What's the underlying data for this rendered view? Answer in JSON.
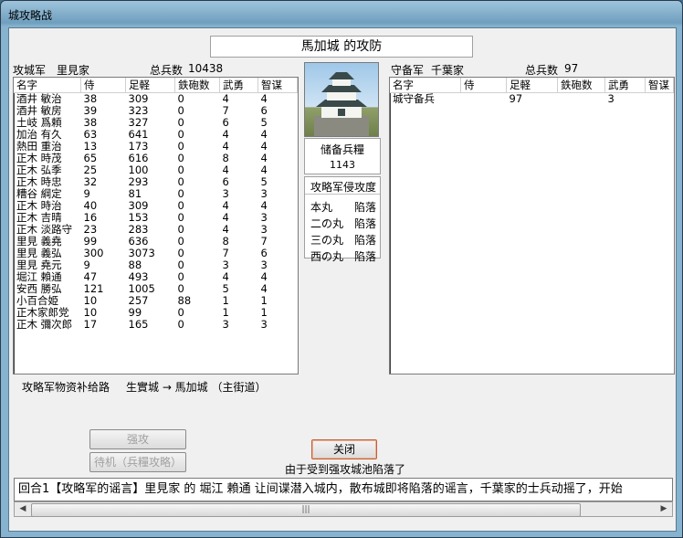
{
  "window": {
    "title": "城攻略战"
  },
  "header": {
    "caption": "馬加城 的攻防"
  },
  "attacker": {
    "label": "攻城军",
    "name": "里見家",
    "total_label": "总兵数",
    "total": "10438",
    "columns": [
      "名字",
      "侍",
      "足軽",
      "鉄砲数",
      "武勇",
      "智谋"
    ],
    "rows": [
      [
        "酒井 敏治",
        "38",
        "309",
        "0",
        "4",
        "4"
      ],
      [
        "酒井 敏房",
        "39",
        "323",
        "0",
        "7",
        "6"
      ],
      [
        "土岐 爲頼",
        "38",
        "327",
        "0",
        "6",
        "5"
      ],
      [
        "加治 有久",
        "63",
        "641",
        "0",
        "4",
        "4"
      ],
      [
        "熱田 重治",
        "13",
        "173",
        "0",
        "4",
        "4"
      ],
      [
        "正木 時茂",
        "65",
        "616",
        "0",
        "8",
        "4"
      ],
      [
        "正木 弘季",
        "25",
        "100",
        "0",
        "4",
        "4"
      ],
      [
        "正木 時忠",
        "32",
        "293",
        "0",
        "6",
        "5"
      ],
      [
        "糟谷 綱定",
        "9",
        "81",
        "0",
        "3",
        "3"
      ],
      [
        "正木 時治",
        "40",
        "309",
        "0",
        "4",
        "4"
      ],
      [
        "正木 吉晴",
        "16",
        "153",
        "0",
        "4",
        "3"
      ],
      [
        "正木 淡路守",
        "23",
        "283",
        "0",
        "4",
        "3"
      ],
      [
        "里見 義堯",
        "99",
        "636",
        "0",
        "8",
        "7"
      ],
      [
        "里見 義弘",
        "300",
        "3073",
        "0",
        "7",
        "6"
      ],
      [
        "里見 堯元",
        "9",
        "88",
        "0",
        "3",
        "3"
      ],
      [
        "堀江 賴通",
        "47",
        "493",
        "0",
        "4",
        "4"
      ],
      [
        "安西 勝弘",
        "121",
        "1005",
        "0",
        "5",
        "4"
      ],
      [
        "小百合姫",
        "10",
        "257",
        "88",
        "1",
        "1"
      ],
      [
        "正木家郎党",
        "10",
        "99",
        "0",
        "1",
        "1"
      ],
      [
        "正木 彌次郎",
        "17",
        "165",
        "0",
        "3",
        "3"
      ]
    ]
  },
  "defender": {
    "label": "守备军",
    "name": "千葉家",
    "total_label": "总兵数",
    "total": "97",
    "columns": [
      "名字",
      "侍",
      "足軽",
      "鉄砲数",
      "武勇",
      "智谋"
    ],
    "rows": [
      [
        "城守备兵",
        "",
        "97",
        "",
        "3",
        ""
      ]
    ]
  },
  "castle": {
    "reserve_label": "储备兵糧",
    "reserve_value": "1143",
    "progress_title": "攻略军侵攻度",
    "progress": [
      {
        "name": "本丸",
        "status": "陷落"
      },
      {
        "name": "二の丸",
        "status": "陷落"
      },
      {
        "name": "三の丸",
        "status": "陷落"
      },
      {
        "name": "西の丸",
        "status": "陷落"
      }
    ]
  },
  "supply": {
    "label": "攻略军物资补给路",
    "route": "生實城 → 馬加城 （主街道）"
  },
  "buttons": {
    "assault": "强攻",
    "wait": "待机（兵糧攻略）",
    "close": "关闭"
  },
  "status_text": "由于受到强攻城池陷落了",
  "log_text": "回合1【攻略军的谣言】里見家 的 堀江 賴通 让间谍潜入城内，散布城即将陷落的谣言，千葉家的士兵动摇了，开始"
}
